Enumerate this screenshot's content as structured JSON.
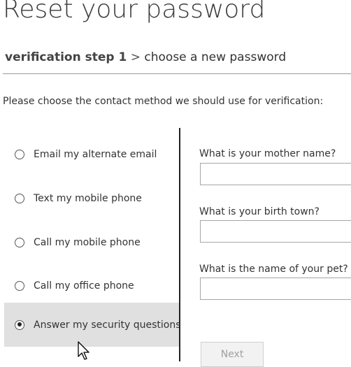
{
  "page": {
    "title": "Reset your password",
    "breadcrumb": {
      "current": "verification step 1",
      "separator": ">",
      "next": "choose a new password"
    },
    "instructions": "Please choose the contact method we should use for verification:"
  },
  "methods": [
    {
      "label": "Email my alternate email",
      "selected": false
    },
    {
      "label": "Text my mobile phone",
      "selected": false
    },
    {
      "label": "Call my mobile phone",
      "selected": false
    },
    {
      "label": "Call my office phone",
      "selected": false
    },
    {
      "label": "Answer my security questions",
      "selected": true
    }
  ],
  "questions": [
    {
      "label": "What is your mother name?",
      "value": ""
    },
    {
      "label": "What is your birth town?",
      "value": ""
    },
    {
      "label": "What is the name of your pet?",
      "value": ""
    }
  ],
  "actions": {
    "next_label": "Next",
    "next_enabled": false
  },
  "colors": {
    "selected_row_bg": "#e0e0e0",
    "divider": "#999999",
    "text": "#333333"
  }
}
